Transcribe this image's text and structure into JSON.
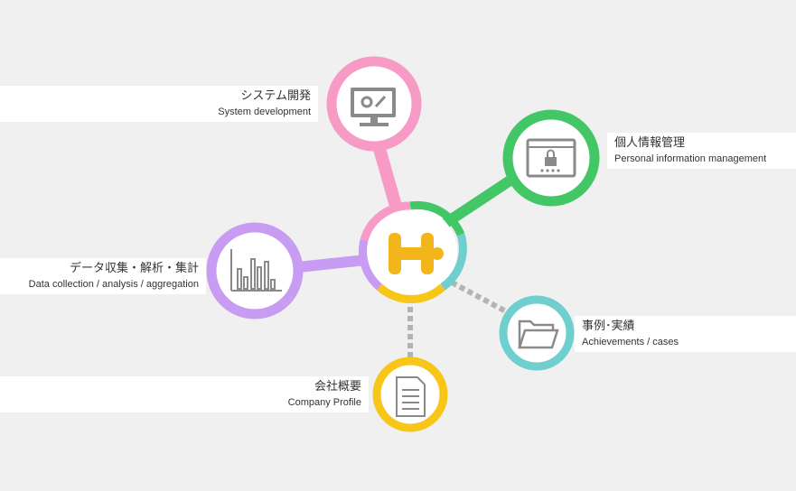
{
  "nodes": {
    "system": {
      "title_jp": "システム開発",
      "title_en": "System development",
      "color": "#f79ac6"
    },
    "personal": {
      "title_jp": "個人情報管理",
      "title_en": "Personal information management",
      "color": "#43c766"
    },
    "data": {
      "title_jp": "データ収集・解析・集計",
      "title_en": "Data collection / analysis / aggregation",
      "color": "#c79cf2"
    },
    "cases": {
      "title_jp": "事例･実績",
      "title_en": "Achievements / cases",
      "color": "#6fcfcf"
    },
    "company": {
      "title_jp": "会社概要",
      "title_en": "Company Profile",
      "color": "#f7c619"
    }
  },
  "center": {
    "logo_color": "#f2b51c",
    "icon": "h-logo-icon"
  },
  "colors": {
    "background": "#f0f0f0",
    "icon_gray": "#8a8a8a",
    "connector_gray": "#b3b3b3"
  }
}
